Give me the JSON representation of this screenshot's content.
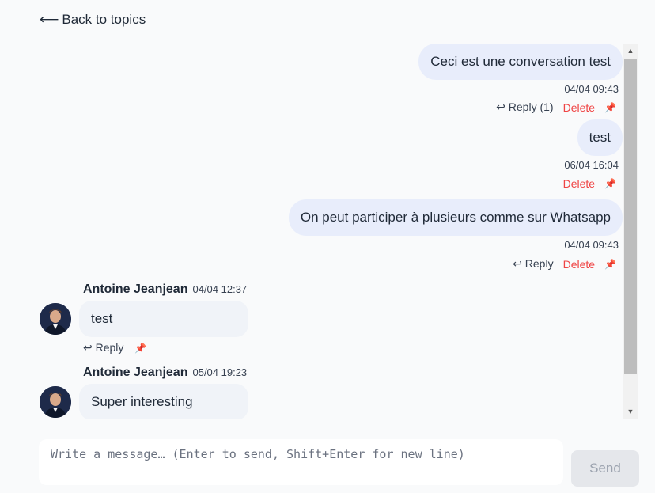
{
  "back_link": {
    "arrow": "⟵",
    "label": "Back to topics"
  },
  "own_messages": [
    {
      "text": "Ceci est une conversation test",
      "time": "04/04 09:43",
      "reply": "↩ Reply (1)",
      "delete": "Delete",
      "pin": "📌"
    },
    {
      "text": "test",
      "time": "06/04 16:04",
      "delete": "Delete",
      "pin": "📌"
    },
    {
      "text": "On peut participer à plusieurs comme sur Whatsapp",
      "time": "04/04 09:43",
      "reply": "↩ Reply",
      "delete": "Delete",
      "pin": "📌"
    }
  ],
  "other_messages": [
    {
      "author": "Antoine Jeanjean",
      "time": "04/04 12:37",
      "text": "test",
      "reply": "↩ Reply",
      "pin": "📌"
    },
    {
      "author": "Antoine Jeanjean",
      "time": "05/04 19:23",
      "text": "Super interesting"
    }
  ],
  "composer": {
    "placeholder": "Write a message… (Enter to send, Shift+Enter for new line)"
  },
  "send_button": {
    "label": "Send"
  },
  "scrollbar": {
    "up": "▲",
    "down": "▼"
  }
}
